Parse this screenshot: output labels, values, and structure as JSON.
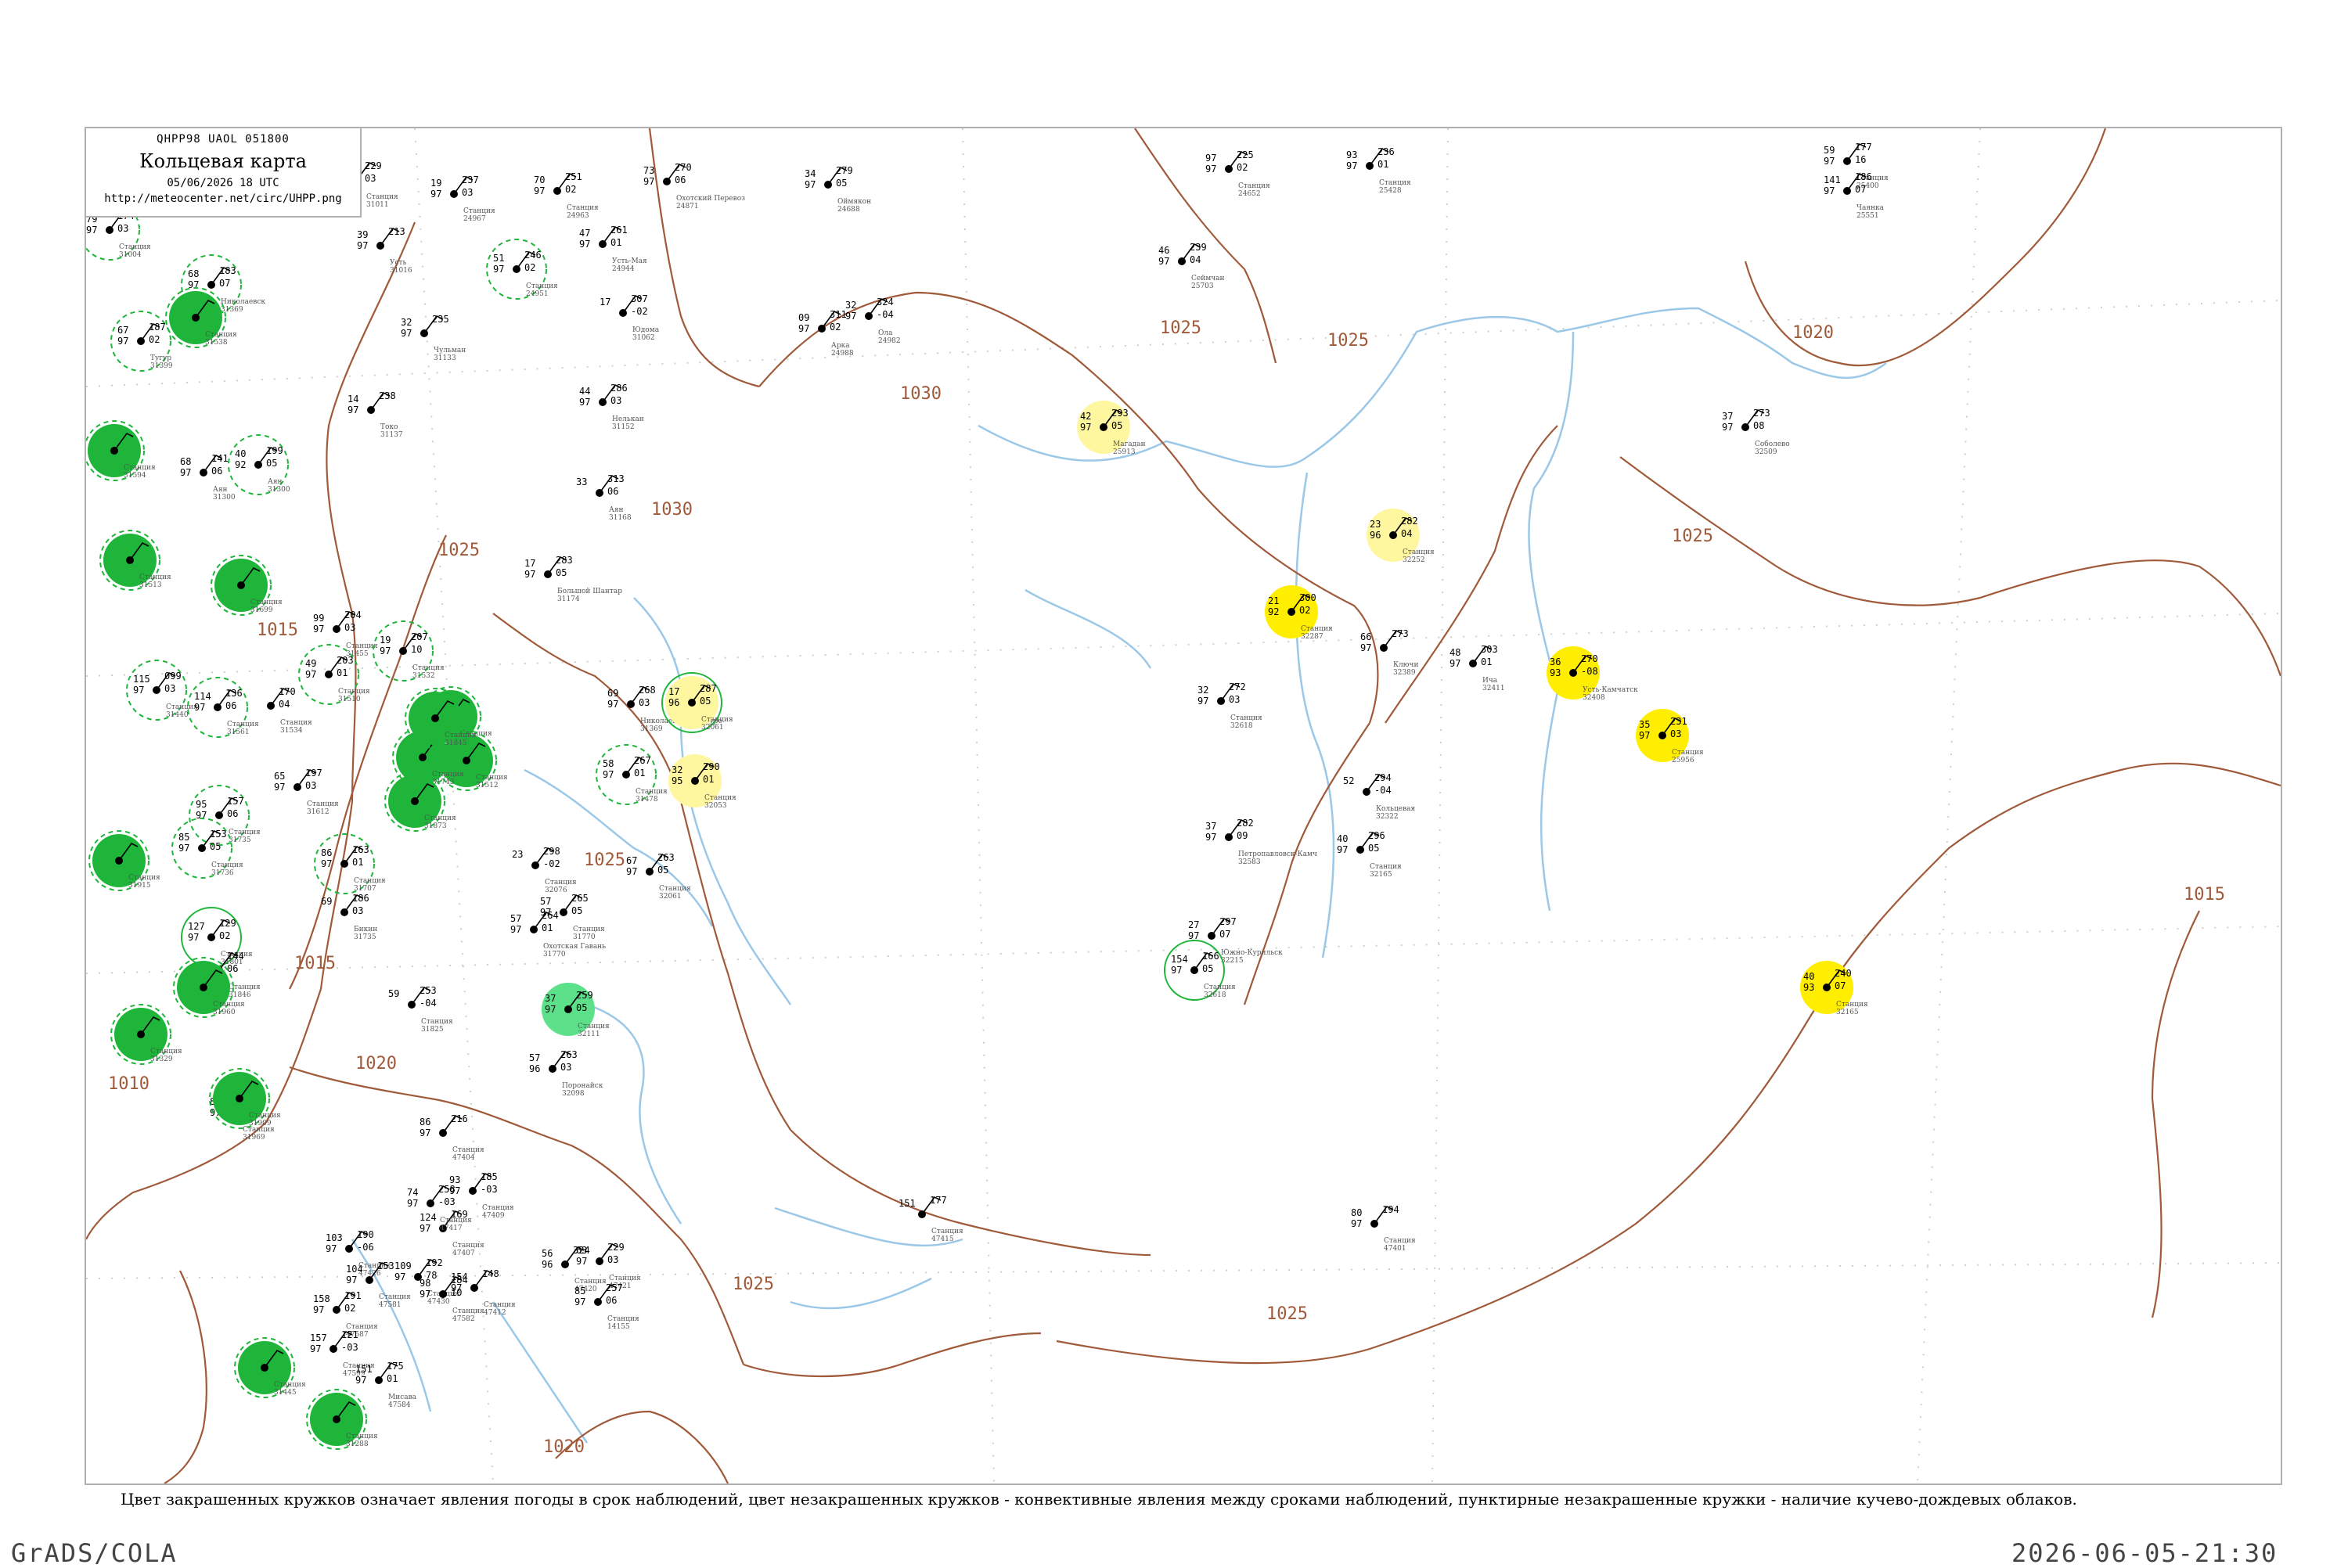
{
  "header": {
    "code_line": "QHPP98  UAOL  051800",
    "title": "Кольцевая карта",
    "date_line": "05/06/2026 18 UTC",
    "url": "http://meteocenter.net/circ/UHPP.png"
  },
  "colors": {
    "isobar": "#a05a3a",
    "river": "#9cc8e8",
    "coast": "#9cc8e8",
    "border": "#b0b0b0",
    "thunder_fill": "#1fb53a",
    "rain_fill": "#ffee00",
    "light_rain_fill": "#fff7a0",
    "teal_fill": "#5de08a",
    "ring_stroke": "#1fb53a"
  },
  "isobar_labels": [
    "1025",
    "1025",
    "1030",
    "1030",
    "1025",
    "1020",
    "1025",
    "1015",
    "1010",
    "1015",
    "1025",
    "1020",
    "1025",
    "1025",
    "1020",
    "1015"
  ],
  "stations": [
    {
      "top": "174",
      "left": "79",
      "mid": "97",
      "right": "03",
      "name": "Станция",
      "id": "31004",
      "fill": "none",
      "ring": "dashed"
    },
    {
      "top": "183",
      "left": "68",
      "mid": "97",
      "right": "07",
      "name": "Николаевск",
      "id": "31369",
      "fill": "none",
      "ring": "dashed"
    },
    {
      "top": "187",
      "left": "67",
      "mid": "97",
      "right": "02",
      "name": "Тугур",
      "id": "31399",
      "fill": "none",
      "ring": "dashed"
    },
    {
      "top": "199",
      "left": "40",
      "mid": "92",
      "right": "05",
      "name": "Аян",
      "id": "31300",
      "fill": "none",
      "ring": "dashed"
    },
    {
      "top": "141",
      "left": "68",
      "mid": "97",
      "right": "06",
      "name": "Аян",
      "id": "31300",
      "fill": "none",
      "ring": "none"
    },
    {
      "top": "204",
      "left": "99",
      "mid": "97",
      "right": "03",
      "name": "Станция",
      "id": "31455",
      "fill": "none",
      "ring": "none"
    },
    {
      "top": "203",
      "left": "49",
      "mid": "97",
      "right": "01",
      "name": "Станция",
      "id": "31510",
      "fill": "none",
      "ring": "dashed"
    },
    {
      "top": "207",
      "left": "19",
      "mid": "97",
      "right": "10",
      "name": "Станция",
      "id": "31532",
      "fill": "none",
      "ring": "dashed"
    },
    {
      "top": "099",
      "left": "115",
      "mid": "97",
      "right": "03",
      "name": "Станция",
      "id": "31440",
      "fill": "none",
      "ring": "dashed"
    },
    {
      "top": "136",
      "left": "114",
      "mid": "97",
      "right": "06",
      "name": "Станция",
      "id": "31561",
      "fill": "none",
      "ring": "dashed"
    },
    {
      "top": "170",
      "left": "",
      "mid": "",
      "right": "04",
      "name": "Станция",
      "id": "31534",
      "fill": "none",
      "ring": "none"
    },
    {
      "top": "197",
      "left": "65",
      "mid": "97",
      "right": "03",
      "name": "Станция",
      "id": "31612",
      "fill": "none",
      "ring": "none"
    },
    {
      "top": "157",
      "left": "95",
      "mid": "97",
      "right": "06",
      "name": "Станция",
      "id": "31735",
      "fill": "none",
      "ring": "dashed"
    },
    {
      "top": "153",
      "left": "85",
      "mid": "97",
      "right": "05",
      "name": "Станция",
      "id": "31736",
      "fill": "none",
      "ring": "dashed"
    },
    {
      "top": "163",
      "left": "86",
      "mid": "97",
      "right": "01",
      "name": "Станция",
      "id": "31707",
      "fill": "none",
      "ring": "dashed"
    },
    {
      "top": "186",
      "left": "69",
      "mid": "",
      "right": "03",
      "name": "Бикин",
      "id": "31735",
      "fill": "none",
      "ring": "none"
    },
    {
      "top": "129",
      "left": "127",
      "mid": "97",
      "right": "02",
      "name": "Станция",
      "id": "31801",
      "fill": "none",
      "ring": "solid"
    },
    {
      "top": "144",
      "left": "",
      "mid": "",
      "right": "06",
      "name": "Станция",
      "id": "31846",
      "fill": "none",
      "ring": "none"
    },
    {
      "top": "173",
      "left": "80",
      "mid": "97",
      "right": "01",
      "name": "Станция",
      "id": "31969",
      "fill": "none",
      "ring": "none"
    },
    {
      "top": "253",
      "left": "59",
      "mid": "",
      "right": "-04",
      "name": "Станция",
      "id": "31825",
      "fill": "none",
      "ring": "none"
    },
    {
      "top": "229",
      "left": "12",
      "mid": "97",
      "right": "03",
      "name": "Станция",
      "id": "31011",
      "fill": "none",
      "ring": "none"
    },
    {
      "top": "237",
      "left": "19",
      "mid": "97",
      "right": "03",
      "name": "Станция",
      "id": "24967",
      "fill": "none",
      "ring": "none"
    },
    {
      "top": "251",
      "left": "70",
      "mid": "97",
      "right": "02",
      "name": "Станция",
      "id": "24963",
      "fill": "none",
      "ring": "none"
    },
    {
      "top": "246",
      "left": "51",
      "mid": "97",
      "right": "02",
      "name": "Станция",
      "id": "24951",
      "fill": "none",
      "ring": "dashed"
    },
    {
      "top": "261",
      "left": "47",
      "mid": "97",
      "right": "01",
      "name": "Усть-Мая",
      "id": "24944",
      "fill": "none",
      "ring": "none"
    },
    {
      "top": "270",
      "left": "73",
      "mid": "97",
      "right": "06",
      "name": "Охотский Перевоз",
      "id": "24871",
      "fill": "none",
      "ring": "none"
    },
    {
      "top": "279",
      "left": "34",
      "mid": "97",
      "right": "05",
      "name": "Оймякон",
      "id": "24688",
      "fill": "none",
      "ring": "none"
    },
    {
      "top": "225",
      "left": "97",
      "mid": "97",
      "right": "02",
      "name": "Станция",
      "id": "24652",
      "fill": "none",
      "ring": "none"
    },
    {
      "top": "236",
      "left": "93",
      "mid": "97",
      "right": "01",
      "name": "Станция",
      "id": "25428",
      "fill": "none",
      "ring": "none"
    },
    {
      "top": "177",
      "left": "59",
      "mid": "97",
      "right": "16",
      "name": "Станция",
      "id": "25400",
      "fill": "none",
      "ring": "none"
    },
    {
      "top": "186",
      "left": "141",
      "mid": "97",
      "right": "07",
      "name": "Чаянка",
      "id": "25551",
      "fill": "none",
      "ring": "none"
    },
    {
      "top": "239",
      "left": "46",
      "mid": "97",
      "right": "04",
      "name": "Сеймчан",
      "id": "25703",
      "fill": "none",
      "ring": "none"
    },
    {
      "top": "213",
      "left": "39",
      "mid": "97",
      "right": "",
      "name": "Усть",
      "id": "31016",
      "fill": "none",
      "ring": "none"
    },
    {
      "top": "235",
      "left": "32",
      "mid": "97",
      "right": "",
      "name": "Чульман",
      "id": "31133",
      "fill": "none",
      "ring": "none"
    },
    {
      "top": "238",
      "left": "14",
      "mid": "97",
      "right": "",
      "name": "Токо",
      "id": "31137",
      "fill": "none",
      "ring": "none"
    },
    {
      "top": "307",
      "left": "17",
      "mid": "",
      "right": "-02",
      "name": "Юдома",
      "id": "31062",
      "fill": "none",
      "ring": "none"
    },
    {
      "top": "286",
      "left": "44",
      "mid": "97",
      "right": "03",
      "name": "Нелькан",
      "id": "31152",
      "fill": "none",
      "ring": "none"
    },
    {
      "top": "311",
      "left": "09",
      "mid": "97",
      "right": "02",
      "name": "Арка",
      "id": "24988",
      "fill": "none",
      "ring": "none"
    },
    {
      "top": "324",
      "left": "32",
      "mid": "97",
      "right": "-04",
      "name": "Ола",
      "id": "24982",
      "fill": "none",
      "ring": "none"
    },
    {
      "top": "313",
      "left": "33",
      "mid": "",
      "right": "06",
      "name": "Аян",
      "id": "31168",
      "fill": "none",
      "ring": "none"
    },
    {
      "top": "283",
      "left": "17",
      "mid": "97",
      "right": "05",
      "name": "Большой Шантар",
      "id": "31174",
      "fill": "none",
      "ring": "none"
    },
    {
      "top": "268",
      "left": "69",
      "mid": "97",
      "right": "03",
      "name": "Николаевск-на-Амуре",
      "id": "31369",
      "fill": "none",
      "ring": "none"
    },
    {
      "top": "287",
      "left": "17",
      "mid": "96",
      "right": "05",
      "name": "Станция",
      "id": "32061",
      "fill": "light_rain",
      "ring": "solid"
    },
    {
      "top": "267",
      "left": "58",
      "mid": "97",
      "right": "01",
      "name": "Станция",
      "id": "31478",
      "fill": "none",
      "ring": "dashed"
    },
    {
      "top": "290",
      "left": "32",
      "mid": "95",
      "right": "01",
      "name": "Станция",
      "id": "32053",
      "fill": "light_rain",
      "ring": "none"
    },
    {
      "top": "263",
      "left": "67",
      "mid": "97",
      "right": "05",
      "name": "Станция",
      "id": "32061",
      "fill": "none",
      "ring": "none"
    },
    {
      "top": "298",
      "left": "23",
      "mid": "",
      "right": "-02",
      "name": "Станция",
      "id": "32076",
      "fill": "none",
      "ring": "none"
    },
    {
      "top": "265",
      "left": "57",
      "mid": "97",
      "right": "05",
      "name": "Станция",
      "id": "31770",
      "fill": "none",
      "ring": "none"
    },
    {
      "top": "264",
      "left": "57",
      "mid": "97",
      "right": "01",
      "name": "Охотская Гавань",
      "id": "31770",
      "fill": "none",
      "ring": "none"
    },
    {
      "top": "259",
      "left": "37",
      "mid": "97",
      "right": "05",
      "name": "Станция",
      "id": "32111",
      "fill": "teal",
      "ring": "none"
    },
    {
      "top": "263",
      "left": "57",
      "mid": "96",
      "right": "03",
      "name": "Поронайск",
      "id": "32098",
      "fill": "none",
      "ring": "none"
    },
    {
      "top": "293",
      "left": "42",
      "mid": "97",
      "right": "05",
      "name": "Магадан",
      "id": "25913",
      "fill": "light_rain",
      "ring": "none"
    },
    {
      "top": "282",
      "left": "23",
      "mid": "96",
      "right": "04",
      "name": "Станция",
      "id": "32252",
      "fill": "light_rain",
      "ring": "none"
    },
    {
      "top": "300",
      "left": "21",
      "mid": "92",
      "right": "02",
      "name": "Станция",
      "id": "32287",
      "fill": "rain",
      "ring": "none"
    },
    {
      "top": "273",
      "left": "66",
      "mid": "97",
      "right": "",
      "name": "Ключи",
      "id": "32389",
      "fill": "none",
      "ring": "none"
    },
    {
      "top": "270",
      "left": "36",
      "mid": "93",
      "right": "-08",
      "name": "Усть-Камчатск",
      "id": "32408",
      "fill": "rain",
      "ring": "none"
    },
    {
      "top": "303",
      "left": "48",
      "mid": "97",
      "right": "01",
      "name": "Ича",
      "id": "32411",
      "fill": "none",
      "ring": "none"
    },
    {
      "top": "272",
      "left": "32",
      "mid": "97",
      "right": "03",
      "name": "Станция",
      "id": "32618",
      "fill": "none",
      "ring": "none"
    },
    {
      "top": "231",
      "left": "35",
      "mid": "97",
      "right": "03",
      "name": "Станция",
      "id": "25956",
      "fill": "rain",
      "ring": "none"
    },
    {
      "top": "273",
      "left": "37",
      "mid": "97",
      "right": "08",
      "name": "Соболево",
      "id": "32509",
      "fill": "none",
      "ring": "none"
    },
    {
      "top": "294",
      "left": "52",
      "mid": "",
      "right": "-04",
      "name": "Кольцевая",
      "id": "32322",
      "fill": "none",
      "ring": "none"
    },
    {
      "top": "282",
      "left": "37",
      "mid": "97",
      "right": "09",
      "name": "Петропавловск-Камч",
      "id": "32583",
      "fill": "none",
      "ring": "none"
    },
    {
      "top": "296",
      "left": "40",
      "mid": "97",
      "right": "05",
      "name": "Станция",
      "id": "32165",
      "fill": "none",
      "ring": "none"
    },
    {
      "top": "297",
      "left": "27",
      "mid": "97",
      "right": "07",
      "name": "Южно-Курильск",
      "id": "32215",
      "fill": "none",
      "ring": "none"
    },
    {
      "top": "166",
      "left": "154",
      "mid": "97",
      "right": "05",
      "name": "Станция",
      "id": "32618",
      "fill": "none",
      "ring": "solid"
    },
    {
      "top": "240",
      "left": "40",
      "mid": "93",
      "right": "07",
      "name": "Станция",
      "id": "32165",
      "fill": "rain",
      "ring": "none"
    },
    {
      "top": "229",
      "left": "63",
      "mid": "97",
      "right": "03",
      "name": "Станция",
      "id": "47421",
      "fill": "none",
      "ring": "none"
    },
    {
      "top": "324",
      "left": "56",
      "mid": "96",
      "right": "",
      "name": "Станция",
      "id": "47420",
      "fill": "none",
      "ring": "none"
    },
    {
      "top": "257",
      "left": "85",
      "mid": "97",
      "right": "06",
      "name": "Станция",
      "id": "14155",
      "fill": "none",
      "ring": "none"
    },
    {
      "top": "177",
      "left": "151",
      "mid": "",
      "right": "",
      "name": "Станция",
      "id": "47415",
      "fill": "none",
      "ring": "none"
    },
    {
      "top": "194",
      "left": "80",
      "mid": "97",
      "right": "",
      "name": "Станция",
      "id": "47401",
      "fill": "none",
      "ring": "none"
    },
    {
      "top": "216",
      "left": "86",
      "mid": "97",
      "right": "",
      "name": "Станция",
      "id": "47404",
      "fill": "none",
      "ring": "none"
    },
    {
      "top": "185",
      "left": "93",
      "mid": "97",
      "right": "-03",
      "name": "Станция",
      "id": "47409",
      "fill": "none",
      "ring": "none"
    },
    {
      "top": "169",
      "left": "124",
      "mid": "97",
      "right": "",
      "name": "Станция",
      "id": "47407",
      "fill": "none",
      "ring": "none"
    },
    {
      "top": "258",
      "left": "74",
      "mid": "97",
      "right": "-03",
      "name": "Станция",
      "id": "47417",
      "fill": "none",
      "ring": "none"
    },
    {
      "top": "190",
      "left": "103",
      "mid": "97",
      "right": "-06",
      "name": "Станция",
      "id": "47426",
      "fill": "none",
      "ring": "none"
    },
    {
      "top": "148",
      "left": "154",
      "mid": "97",
      "right": "",
      "name": "Станция",
      "id": "47412",
      "fill": "none",
      "ring": "none"
    },
    {
      "top": "192",
      "left": "109",
      "mid": "97",
      "right": "78",
      "name": "Станция",
      "id": "47430",
      "fill": "none",
      "ring": "none"
    },
    {
      "top": "153",
      "left": "104",
      "mid": "97",
      "right": "",
      "name": "Станция",
      "id": "47581",
      "fill": "none",
      "ring": "none"
    },
    {
      "top": "184",
      "left": "98",
      "mid": "97",
      "right": "10",
      "name": "Станция",
      "id": "47582",
      "fill": "none",
      "ring": "none"
    },
    {
      "top": "191",
      "left": "158",
      "mid": "97",
      "right": "02",
      "name": "Станция",
      "id": "47587",
      "fill": "none",
      "ring": "none"
    },
    {
      "top": "121",
      "left": "157",
      "mid": "97",
      "right": "-03",
      "name": "Станция",
      "id": "47599",
      "fill": "none",
      "ring": "none"
    },
    {
      "top": "175",
      "left": "151",
      "mid": "97",
      "right": "01",
      "name": "Мисава",
      "id": "47584",
      "fill": "none",
      "ring": "none"
    },
    {
      "top": "",
      "left": "",
      "mid": "",
      "right": "",
      "name": "Станция",
      "id": "31445",
      "fill": "thunder",
      "ring": "dashed"
    },
    {
      "top": "",
      "left": "",
      "mid": "",
      "right": "",
      "name": "Станция",
      "id": "31288",
      "fill": "thunder",
      "ring": "dashed"
    },
    {
      "top": "",
      "left": "",
      "mid": "",
      "right": "",
      "name": "Станция",
      "id": "31594",
      "fill": "thunder",
      "ring": "dashed"
    },
    {
      "top": "",
      "left": "",
      "mid": "",
      "right": "",
      "name": "Станция",
      "id": "31538",
      "fill": "thunder",
      "ring": "dashed"
    },
    {
      "top": "",
      "left": "",
      "mid": "",
      "right": "",
      "name": "Станция",
      "id": "31513",
      "fill": "thunder",
      "ring": "dashed"
    },
    {
      "top": "",
      "left": "",
      "mid": "",
      "right": "",
      "name": "Станция",
      "id": "31699",
      "fill": "thunder",
      "ring": "dashed"
    },
    {
      "top": "",
      "left": "",
      "mid": "",
      "right": "",
      "name": "Станция",
      "id": "31702",
      "fill": "thunder",
      "ring": "dashed"
    },
    {
      "top": "",
      "left": "",
      "mid": "",
      "right": "",
      "name": "Станция",
      "id": "31512",
      "fill": "thunder",
      "ring": "dashed"
    },
    {
      "top": "",
      "left": "",
      "mid": "",
      "right": "",
      "name": "Станция",
      "id": "31743",
      "fill": "thunder",
      "ring": "dashed"
    },
    {
      "top": "",
      "left": "",
      "mid": "",
      "right": "",
      "name": "Станция",
      "id": "31845",
      "fill": "thunder",
      "ring": "dashed"
    },
    {
      "top": "",
      "left": "",
      "mid": "",
      "right": "",
      "name": "Станция",
      "id": "31873",
      "fill": "thunder",
      "ring": "dashed"
    },
    {
      "top": "",
      "left": "",
      "mid": "",
      "right": "",
      "name": "Станция",
      "id": "31915",
      "fill": "thunder",
      "ring": "dashed"
    },
    {
      "top": "",
      "left": "",
      "mid": "",
      "right": "",
      "name": "Станция",
      "id": "31960",
      "fill": "thunder",
      "ring": "dashed"
    },
    {
      "top": "",
      "left": "",
      "mid": "",
      "right": "",
      "name": "Станция",
      "id": "31329",
      "fill": "thunder",
      "ring": "dashed"
    },
    {
      "top": "",
      "left": "",
      "mid": "",
      "right": "",
      "name": "Станция",
      "id": "31909",
      "fill": "thunder",
      "ring": "dashed"
    }
  ],
  "legend_note": "Цвет закрашенных кружков означает явления погоды в срок наблюдений, цвет незакрашенных кружков - конвективные явления между сроками наблюдений, пунктирные незакрашенные кружки - наличие кучево-дождевых облаков.",
  "footer": {
    "left": "GrADS/COLA",
    "right": "2026-06-05-21:30"
  }
}
